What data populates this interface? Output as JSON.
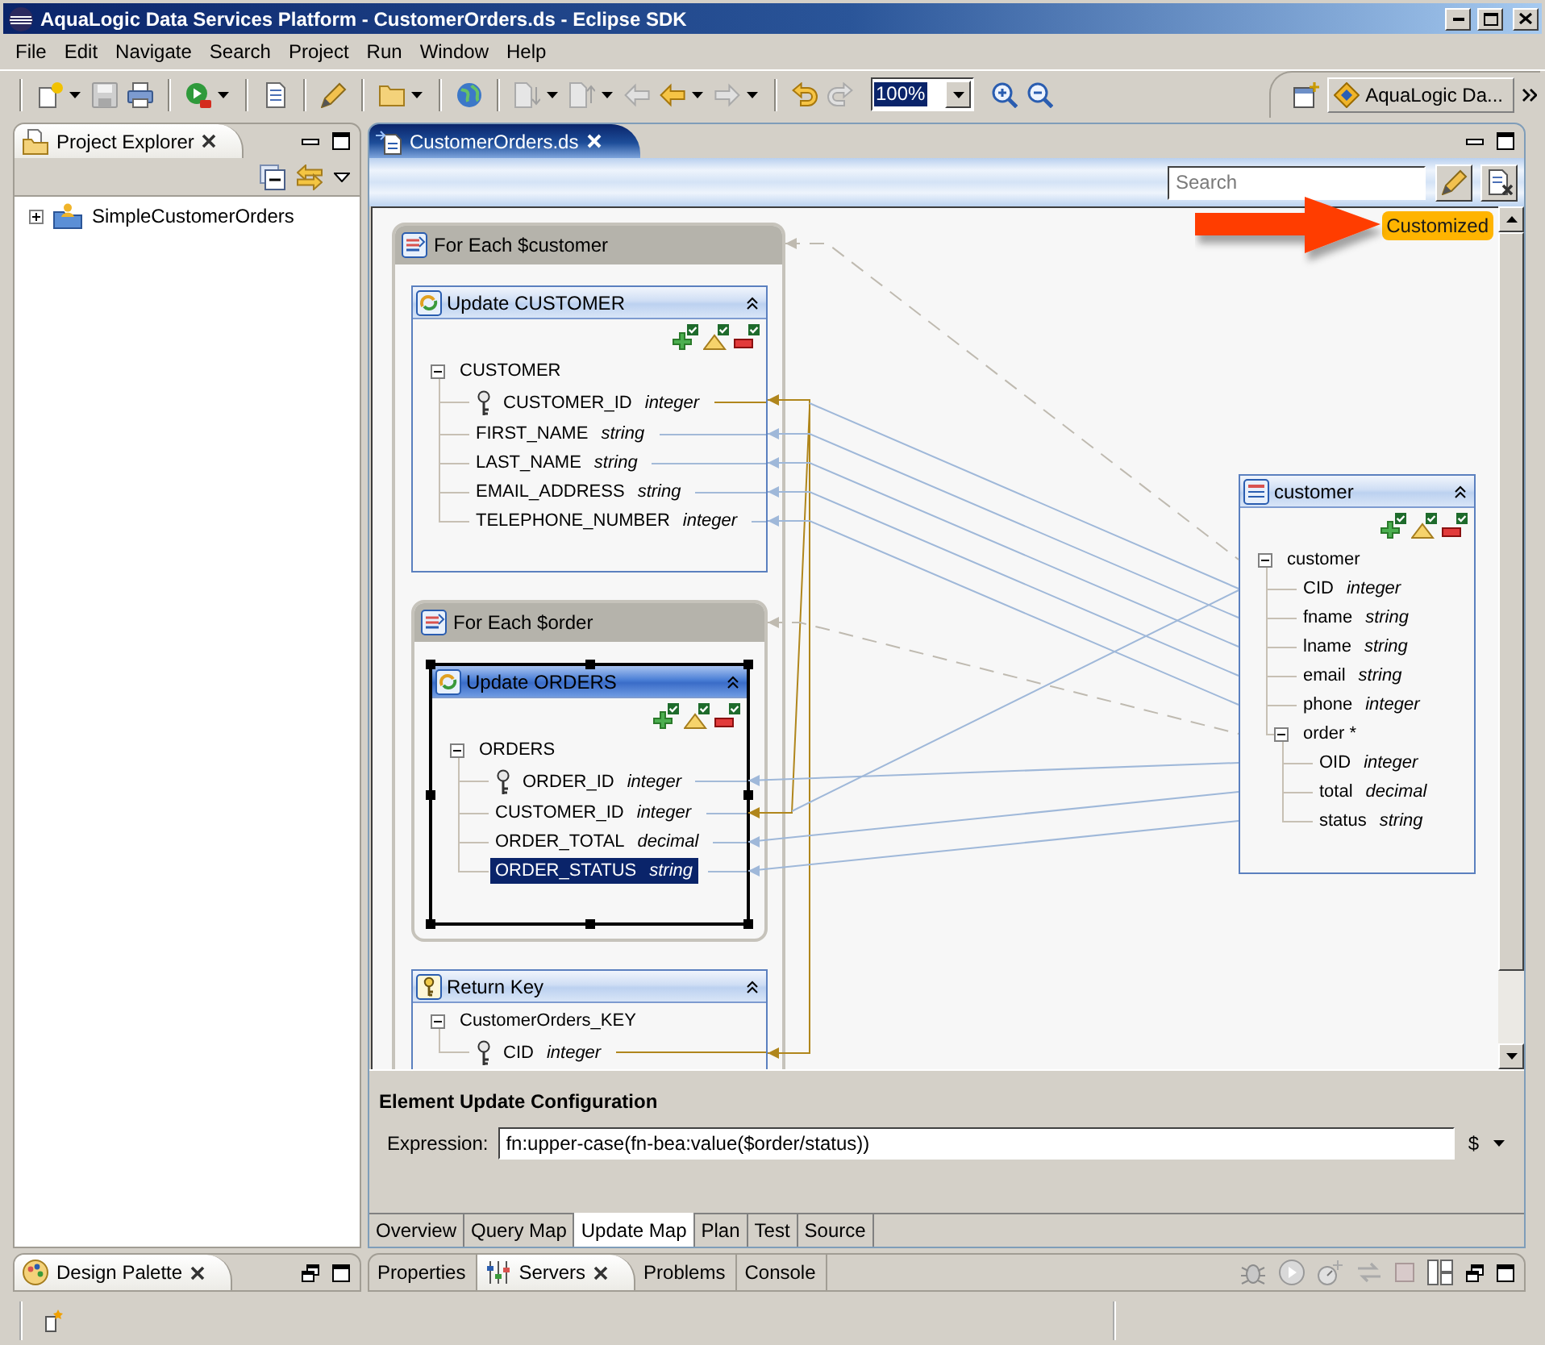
{
  "window": {
    "title": "AquaLogic Data Services Platform - CustomerOrders.ds - Eclipse SDK"
  },
  "menu": [
    "File",
    "Edit",
    "Navigate",
    "Search",
    "Project",
    "Run",
    "Window",
    "Help"
  ],
  "toolbar": {
    "zoom": "100%",
    "perspective": "AquaLogic Da..."
  },
  "project_explorer": {
    "title": "Project Explorer",
    "tree": [
      {
        "label": "SimpleCustomerOrders",
        "expanded": false
      }
    ]
  },
  "design_palette": {
    "title": "Design Palette"
  },
  "editor": {
    "tab": "CustomerOrders.ds",
    "search": {
      "placeholder": "Search"
    },
    "badge": "Customized",
    "diagram": {
      "nodes": [
        {
          "kind": "loop",
          "title": "For Each $customer",
          "blocks": [
            {
              "kind": "update",
              "title": "Update CUSTOMER",
              "selected": false,
              "tree": {
                "name": "CUSTOMER",
                "expanded": true,
                "selected": false,
                "children": [
                  {
                    "name": "CUSTOMER_ID",
                    "type": "integer",
                    "key": true,
                    "color": "#b0861c",
                    "selected": false
                  },
                  {
                    "name": "FIRST_NAME",
                    "type": "string",
                    "key": false,
                    "color": "#a3bad8",
                    "selected": false
                  },
                  {
                    "name": "LAST_NAME",
                    "type": "string",
                    "key": false,
                    "color": "#a3bad8",
                    "selected": false
                  },
                  {
                    "name": "EMAIL_ADDRESS",
                    "type": "string",
                    "key": false,
                    "color": "#a3bad8",
                    "selected": false
                  },
                  {
                    "name": "TELEPHONE_NUMBER",
                    "type": "integer",
                    "key": false,
                    "color": "#a3bad8",
                    "selected": false
                  }
                ]
              }
            },
            {
              "kind": "loop",
              "title": "For Each $order",
              "blocks": [
                {
                  "kind": "update",
                  "title": "Update ORDERS",
                  "selected": true,
                  "tree": {
                    "name": "ORDERS",
                    "expanded": true,
                    "selected": false,
                    "children": [
                      {
                        "name": "ORDER_ID",
                        "type": "integer",
                        "key": true,
                        "color": "#a3bad8",
                        "selected": false
                      },
                      {
                        "name": "CUSTOMER_ID",
                        "type": "integer",
                        "key": false,
                        "color": "#a3bad8",
                        "selected": false
                      },
                      {
                        "name": "ORDER_TOTAL",
                        "type": "decimal",
                        "key": false,
                        "color": "#a3bad8",
                        "selected": false
                      },
                      {
                        "name": "ORDER_STATUS",
                        "type": "string",
                        "key": false,
                        "color": "#a3bad8",
                        "selected": true
                      }
                    ]
                  }
                }
              ]
            },
            {
              "kind": "key",
              "title": "Return Key",
              "selected": false,
              "tree": {
                "name": "CustomerOrders_KEY",
                "expanded": true,
                "selected": false,
                "children": [
                  {
                    "name": "CID",
                    "type": "integer",
                    "key": true,
                    "color": "#b0861c",
                    "selected": false
                  }
                ]
              }
            }
          ]
        },
        {
          "kind": "source",
          "title": "customer",
          "selected": false,
          "tree": {
            "name": "customer",
            "expanded": true,
            "selected": false,
            "children": [
              {
                "name": "CID",
                "type": "integer",
                "key": false,
                "selected": false
              },
              {
                "name": "fname",
                "type": "string",
                "key": false,
                "selected": false
              },
              {
                "name": "lname",
                "type": "string",
                "key": false,
                "selected": false
              },
              {
                "name": "email",
                "type": "string",
                "key": false,
                "selected": false
              },
              {
                "name": "phone",
                "type": "integer",
                "key": false,
                "selected": false
              },
              {
                "name": "order *",
                "expanded": true,
                "selected": false,
                "children": [
                  {
                    "name": "OID",
                    "type": "integer",
                    "key": false,
                    "selected": false
                  },
                  {
                    "name": "total",
                    "type": "decimal",
                    "key": false,
                    "selected": false
                  },
                  {
                    "name": "status",
                    "type": "string",
                    "key": false,
                    "selected": false
                  }
                ]
              }
            ]
          }
        }
      ]
    },
    "configuration": {
      "title": "Element Update Configuration",
      "label": "Expression:",
      "expression": "fn:upper-case(fn-bea:value($order/status))",
      "variable_menu": "$"
    },
    "pages": [
      {
        "label": "Overview",
        "selected": false
      },
      {
        "label": "Query Map",
        "selected": false
      },
      {
        "label": "Update Map",
        "selected": true
      },
      {
        "label": "Plan",
        "selected": false
      },
      {
        "label": "Test",
        "selected": false
      },
      {
        "label": "Source",
        "selected": false
      }
    ]
  },
  "bottom_views": [
    {
      "label": "Properties",
      "selected": false
    },
    {
      "label": "Servers",
      "selected": true
    },
    {
      "label": "Problems",
      "selected": false
    },
    {
      "label": "Console",
      "selected": false
    }
  ]
}
